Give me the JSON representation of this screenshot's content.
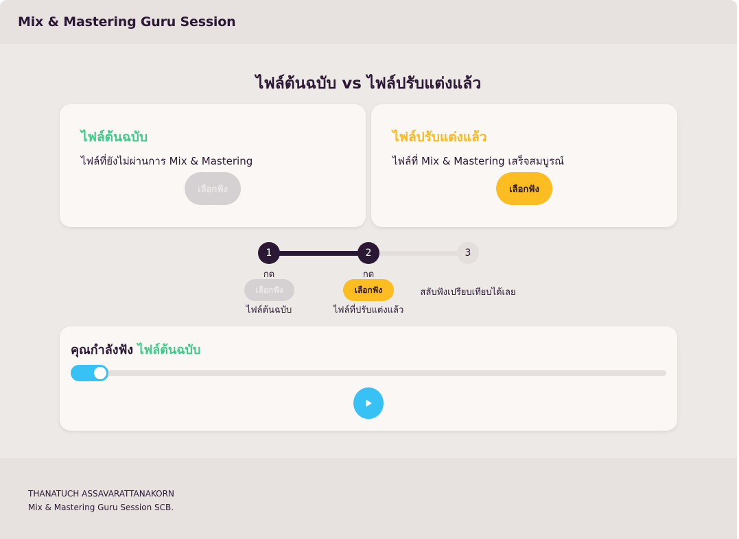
{
  "header": {
    "title": "Mix & Mastering Guru Session"
  },
  "compare": {
    "title": "ไฟล์ต้นฉบับ vs ไฟล์ปรับแต่งแล้ว"
  },
  "cards": {
    "original": {
      "title": "ไฟล์ต้นฉบับ",
      "description": "ไฟล์ที่ยังไม่ผ่านการ Mix & Mastering",
      "button_label": "เลือกฟัง",
      "state": "selected-disabled"
    },
    "mastered": {
      "title": "ไฟล์ปรับแต่งแล้ว",
      "description": "ไฟล์ที่ Mix & Mastering เสร็จสมบูรณ์",
      "button_label": "เลือกฟัง",
      "state": "available"
    }
  },
  "steps": [
    {
      "number": "1",
      "prefix": "กด",
      "pill_label": "เลือกฟัง",
      "caption": "ไฟล์ต้นฉบับ",
      "status": "done"
    },
    {
      "number": "2",
      "prefix": "กด",
      "pill_label": "เลือกฟัง",
      "caption": "ไฟล์ที่ปรับแต่งแล้ว",
      "status": "current"
    },
    {
      "number": "3",
      "caption": "สลับฟังเปรียบเทียบได้เลย",
      "status": "todo"
    }
  ],
  "player": {
    "label": "คุณกำลังฟัง",
    "current_file": "ไฟล์ต้นฉบับ",
    "progress": 0.05
  },
  "footer": {
    "line1": "THANATUCH ASSAVARATTANAKORN",
    "line2": "Mix & Mastering Guru Session SCB."
  },
  "colors": {
    "dark": "#2b1834",
    "green": "#3fcb8a",
    "yellow": "#fbbd22",
    "blue": "#38c1f5",
    "gray_pill": "#d5d0d1"
  },
  "icons": {
    "play": "play-icon"
  }
}
